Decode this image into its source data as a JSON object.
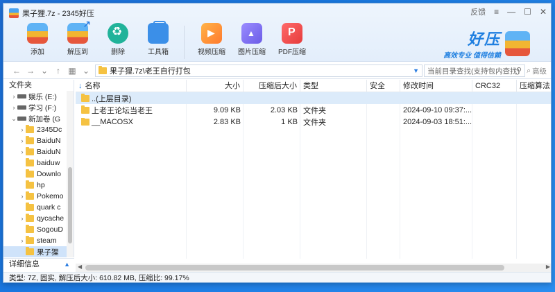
{
  "window": {
    "title": "果子狸.7z - 2345好压",
    "feedback": "反馈"
  },
  "toolbar": {
    "items": [
      {
        "label": "添加",
        "icon": "add-archive-icon"
      },
      {
        "label": "解压到",
        "icon": "extract-icon"
      },
      {
        "label": "删除",
        "icon": "delete-icon"
      },
      {
        "label": "工具箱",
        "icon": "toolbox-icon"
      },
      {
        "label": "视频压缩",
        "icon": "video-compress-icon"
      },
      {
        "label": "图片压缩",
        "icon": "image-compress-icon"
      },
      {
        "label": "PDF压缩",
        "icon": "pdf-compress-icon"
      }
    ]
  },
  "brand": {
    "name": "好压",
    "slogan": "高效专业 值得信赖"
  },
  "nav": {
    "path": "果子狸.7z\\老王自行打包",
    "search_placeholder": "当前目录查找(支持包内查找)",
    "advanced_search": "高级"
  },
  "tree": {
    "header": "文件夹",
    "items": [
      {
        "label": "娱乐 (E:)",
        "kind": "drive",
        "arrow": ">"
      },
      {
        "label": "学习 (F:)",
        "kind": "drive",
        "arrow": ">"
      },
      {
        "label": "新加卷 (G",
        "kind": "drive",
        "arrow": "v"
      },
      {
        "label": "2345Dc",
        "kind": "folder",
        "arrow": ">"
      },
      {
        "label": "BaiduN",
        "kind": "folder",
        "arrow": ">"
      },
      {
        "label": "BaiduN",
        "kind": "folder",
        "arrow": ">"
      },
      {
        "label": "baiduw",
        "kind": "folder",
        "arrow": ""
      },
      {
        "label": "Downlo",
        "kind": "folder",
        "arrow": ""
      },
      {
        "label": "hp",
        "kind": "folder",
        "arrow": ""
      },
      {
        "label": "Pokemo",
        "kind": "folder",
        "arrow": ">"
      },
      {
        "label": "quark c",
        "kind": "folder",
        "arrow": ""
      },
      {
        "label": "qycache",
        "kind": "folder",
        "arrow": ">"
      },
      {
        "label": "SogouD",
        "kind": "folder",
        "arrow": ""
      },
      {
        "label": "steam",
        "kind": "folder",
        "arrow": ">"
      },
      {
        "label": "果子狸",
        "kind": "folder",
        "arrow": "",
        "selected": true
      }
    ],
    "detail_label": "详细信息"
  },
  "list": {
    "columns": [
      "名称",
      "大小",
      "压缩后大小",
      "类型",
      "安全",
      "修改时间",
      "CRC32",
      "压缩算法"
    ],
    "rows": [
      {
        "name": "..(上层目录)",
        "size": "",
        "csize": "",
        "type": "",
        "security": "",
        "mtime": "",
        "crc": "",
        "method": "",
        "highlight": true
      },
      {
        "name": "上老王论坛当老王",
        "size": "9.09 KB",
        "csize": "2.03 KB",
        "type": "文件夹",
        "security": "",
        "mtime": "2024-09-10 09:37:...",
        "crc": "",
        "method": ""
      },
      {
        "name": "__MACOSX",
        "size": "2.83 KB",
        "csize": "1 KB",
        "type": "文件夹",
        "security": "",
        "mtime": "2024-09-03 18:51:...",
        "crc": "",
        "method": ""
      }
    ]
  },
  "status": {
    "text": "类型: 7Z, 固实, 解压后大小: 610.82 MB, 压缩比: 99.17%"
  }
}
